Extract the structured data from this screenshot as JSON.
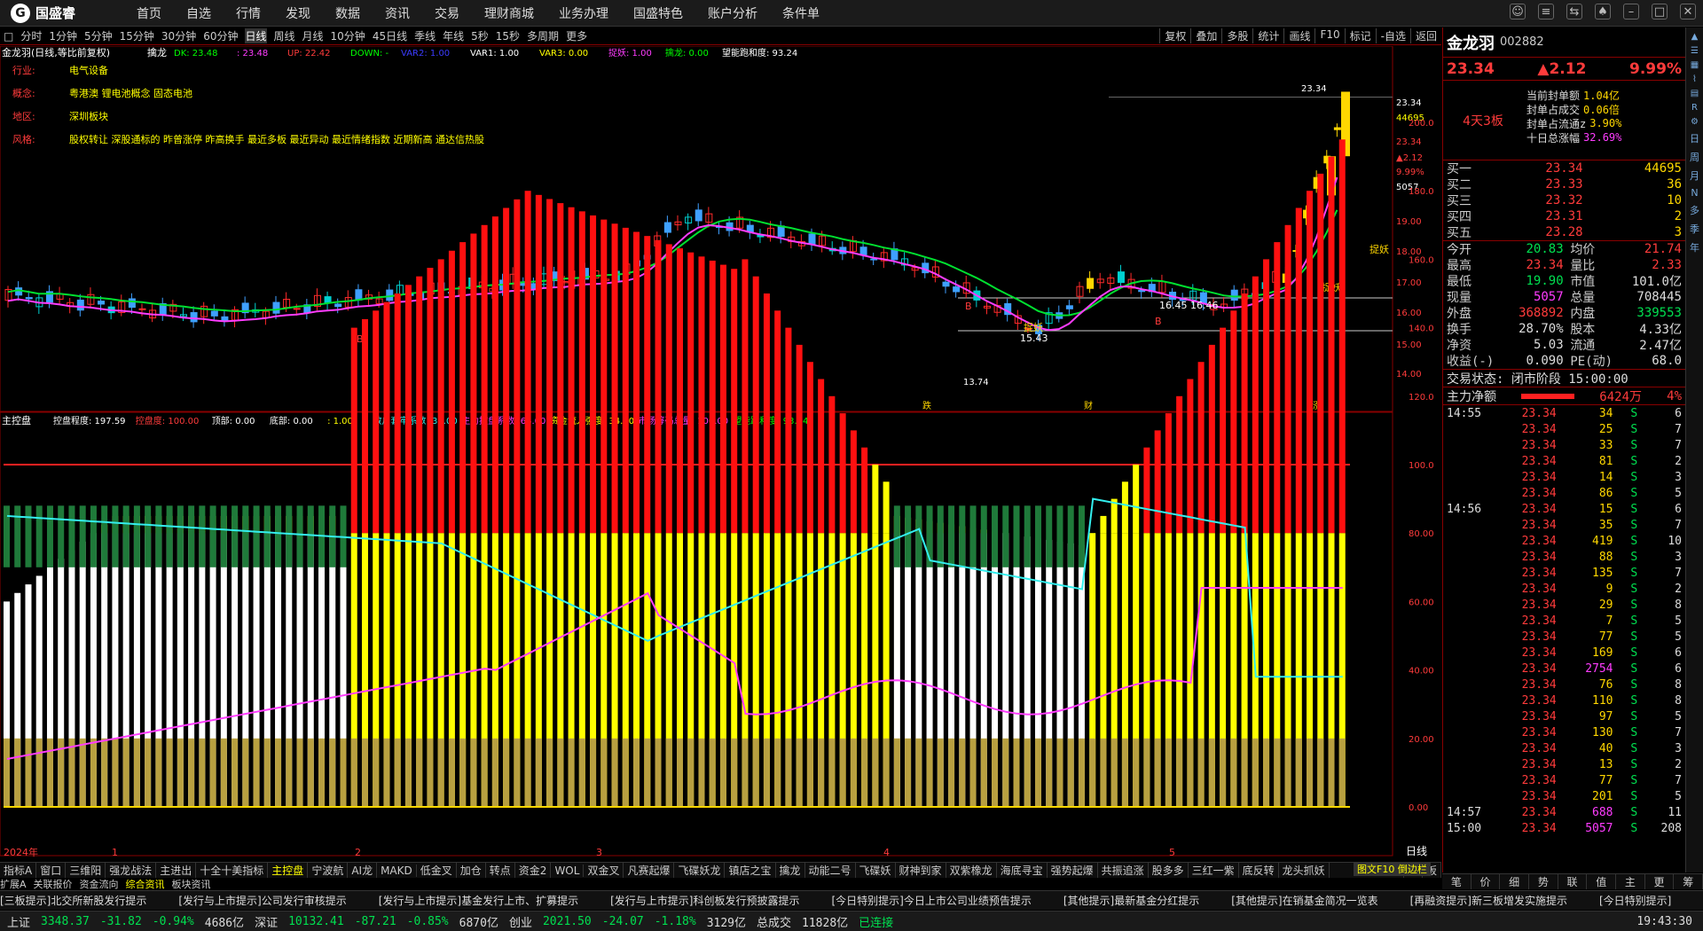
{
  "app": {
    "logo": "国盛睿"
  },
  "menu": [
    "首页",
    "自选",
    "行情",
    "发现",
    "数据",
    "资讯",
    "交易",
    "理财商城",
    "业务办理",
    "国盛特色",
    "账户分析",
    "条件单"
  ],
  "window_icons": [
    "message-icon",
    "menu-icon",
    "restore-icon",
    "skin-icon",
    "minimize-icon",
    "maximize-icon",
    "close-icon"
  ],
  "periods": [
    "分时",
    "1分钟",
    "5分钟",
    "15分钟",
    "30分钟",
    "60分钟",
    "日线",
    "周线",
    "月线",
    "10分钟",
    "45日线",
    "季线",
    "年线",
    "5秒",
    "15秒",
    "多周期",
    "更多"
  ],
  "active_period": "日线",
  "toolbar_right": [
    "复权",
    "叠加",
    "多股",
    "统计",
    "画线",
    "F10",
    "标记",
    "-自选",
    "返回"
  ],
  "kline": {
    "title": "金龙羽(日线,等比前复权)",
    "indicator": "擒龙",
    "params": [
      {
        "t": "DK: 23.48",
        "c": "#00ff00"
      },
      {
        "t": ": 23.48",
        "c": "#ff3cff"
      },
      {
        "t": "UP: 22.42",
        "c": "#ff3b3b"
      },
      {
        "t": "DOWN: -",
        "c": "#00ff00"
      },
      {
        "t": "VAR2: 1.00",
        "c": "#3b3bff"
      },
      {
        "t": "VAR1: 1.00",
        "c": "#ffffff"
      },
      {
        "t": "VAR3: 0.00",
        "c": "#ffff00"
      },
      {
        "t": "捉妖: 1.00",
        "c": "#ff3cff"
      },
      {
        "t": "擒龙: 0.00",
        "c": "#00ff00"
      },
      {
        "t": "望能跑和度: 93.24",
        "c": "#ffffff"
      }
    ],
    "info": [
      {
        "k": "行业:",
        "v": "电气设备"
      },
      {
        "k": "概念:",
        "v": "粤港澳 锂电池概念 固态电池"
      },
      {
        "k": "地区:",
        "v": "深圳板块"
      },
      {
        "k": "风格:",
        "v": "股权转让 深股通标的 昨曾涨停 昨高换手 最近多板 最近异动 最近情绪指数 近期新高 通达信热股"
      }
    ],
    "yaxis": [
      "23.34",
      "44695",
      "23.34",
      "▲2.12",
      "9.99%",
      "5057",
      "19.00",
      "18.00",
      "17.00",
      "16.00",
      "15.00",
      "14.00"
    ],
    "low_label": "13.74",
    "high_label": "23.34",
    "annotations": [
      "捉妖",
      "捉妖",
      "捉妖",
      "B",
      "B",
      "B",
      "15.43",
      "16.45",
      "16.46"
    ],
    "markers": [
      "跌",
      "财",
      "涨"
    ]
  },
  "osc": {
    "title": "主控盘",
    "params": [
      {
        "t": "控盘程度: 197.59",
        "c": "#ffffff"
      },
      {
        "t": "控盘度: 100.00",
        "c": "#ff3b3b"
      },
      {
        "t": "顶部: 0.00",
        "c": "#ffffff"
      },
      {
        "t": "底部: 0.00",
        "c": "#ffffff"
      },
      {
        "t": ": 1.00",
        "c": "#ffff00"
      },
      {
        "t": "散户套牢系数: 35.00",
        "c": "#3ee"
      },
      {
        "t": "主力控盘系数: 64.00",
        "c": "#ff3cff"
      },
      {
        "t": "资金流入强度: 34.00",
        "c": "#ffff00"
      },
      {
        "t": "市场筹码总量: 106.00",
        "c": "#ff3cff"
      },
      {
        "t": "望能跑和度: 93.24",
        "c": "#00ff00"
      }
    ],
    "yaxis": [
      "200.0",
      "180.0",
      "160.0",
      "140.0",
      "120.0",
      "100.0",
      "80.00",
      "60.00",
      "40.00",
      "20.00",
      "0.00"
    ]
  },
  "xaxis": [
    "2024年",
    "1",
    "2",
    "3",
    "4",
    "5"
  ],
  "xaxis_right": "日线",
  "bottom_tabs": [
    "指标A",
    "窗口",
    "三维阳",
    "强龙战法",
    "主进出",
    "十全十美指标",
    "主控盘",
    "宁波航",
    "AI龙",
    "MAKD",
    "低金叉",
    "加仓",
    "转点",
    "资金2",
    "WOL",
    "双金叉",
    "凡赛起爆",
    "飞碟妖龙",
    "镇店之宝",
    "擒龙",
    "动能二号",
    "飞碟妖",
    "财神到家",
    "双紫橡龙",
    "海底寻宝",
    "强势起爆",
    "共振追涨",
    "股多多",
    "三红一紫",
    "底反转",
    "龙头抓妖"
  ],
  "bottom_tabs_right": [
    "指标B",
    "模",
    "板"
  ],
  "active_tab": "主控盘",
  "subtabs": [
    "扩展A",
    "关联报价",
    "资金流向",
    "综合资讯",
    "板块资讯"
  ],
  "quote": {
    "name": "金龙羽",
    "code": "002882",
    "price": "23.34",
    "change": "▲2.12",
    "pct": "9.99%",
    "limit": {
      "label": "4天3板",
      "rows": [
        {
          "k": "当前封单额",
          "v": "1.04亿"
        },
        {
          "k": "封单占成交",
          "v": "0.06倍"
        },
        {
          "k": "封单占流通z",
          "v": "3.90%"
        },
        {
          "k": "十日总涨幅",
          "v": "32.69%"
        }
      ]
    },
    "buys": [
      {
        "k": "买一",
        "p": "23.34",
        "v": "44695"
      },
      {
        "k": "买二",
        "p": "23.33",
        "v": "36"
      },
      {
        "k": "买三",
        "p": "23.32",
        "v": "10"
      },
      {
        "k": "买四",
        "p": "23.31",
        "v": "2"
      },
      {
        "k": "买五",
        "p": "23.28",
        "v": "3"
      }
    ],
    "stats": [
      {
        "k1": "今开",
        "v1": "20.83",
        "c1": "green",
        "k2": "均价",
        "v2": "21.74",
        "c2": "red"
      },
      {
        "k1": "最高",
        "v1": "23.34",
        "c1": "red",
        "k2": "量比",
        "v2": "2.33",
        "c2": "red"
      },
      {
        "k1": "最低",
        "v1": "19.90",
        "c1": "green",
        "k2": "市值",
        "v2": "101.0亿",
        "c2": "white"
      },
      {
        "k1": "现量",
        "v1": "5057",
        "c1": "mag",
        "k2": "总量",
        "v2": "708445",
        "c2": "white"
      },
      {
        "k1": "外盘",
        "v1": "368892",
        "c1": "red",
        "k2": "内盘",
        "v2": "339553",
        "c2": "green"
      },
      {
        "k1": "换手",
        "v1": "28.70%",
        "c1": "white",
        "k2": "股本",
        "v2": "4.33亿",
        "c2": "white"
      },
      {
        "k1": "净资",
        "v1": "5.03",
        "c1": "white",
        "k2": "流通",
        "v2": "2.47亿",
        "c2": "white"
      },
      {
        "k1": "收益(-)",
        "v1": "0.090",
        "c1": "white",
        "k2": "PE(动)",
        "v2": "68.0",
        "c2": "white"
      }
    ],
    "state": "交易状态: 闭市阶段 15:00:00",
    "main_flow": {
      "label": "主力净额",
      "value": "6424万",
      "pct": "4%"
    },
    "ticks": [
      {
        "t": "14:55",
        "p": "23.34",
        "v": "34",
        "c": "6"
      },
      {
        "t": "",
        "p": "23.34",
        "v": "25",
        "c": "7"
      },
      {
        "t": "",
        "p": "23.34",
        "v": "33",
        "c": "7"
      },
      {
        "t": "",
        "p": "23.34",
        "v": "81",
        "c": "2"
      },
      {
        "t": "",
        "p": "23.34",
        "v": "14",
        "c": "3"
      },
      {
        "t": "",
        "p": "23.34",
        "v": "86",
        "c": "5"
      },
      {
        "t": "14:56",
        "p": "23.34",
        "v": "15",
        "c": "6"
      },
      {
        "t": "",
        "p": "23.34",
        "v": "35",
        "c": "7"
      },
      {
        "t": "",
        "p": "23.34",
        "v": "419",
        "c": "10"
      },
      {
        "t": "",
        "p": "23.34",
        "v": "88",
        "c": "3"
      },
      {
        "t": "",
        "p": "23.34",
        "v": "135",
        "c": "7"
      },
      {
        "t": "",
        "p": "23.34",
        "v": "9",
        "c": "2"
      },
      {
        "t": "",
        "p": "23.34",
        "v": "29",
        "c": "8"
      },
      {
        "t": "",
        "p": "23.34",
        "v": "7",
        "c": "5"
      },
      {
        "t": "",
        "p": "23.34",
        "v": "77",
        "c": "5"
      },
      {
        "t": "",
        "p": "23.34",
        "v": "169",
        "c": "6"
      },
      {
        "t": "",
        "p": "23.34",
        "v": "2754",
        "c": "6"
      },
      {
        "t": "",
        "p": "23.34",
        "v": "76",
        "c": "8"
      },
      {
        "t": "",
        "p": "23.34",
        "v": "110",
        "c": "8"
      },
      {
        "t": "",
        "p": "23.34",
        "v": "97",
        "c": "5"
      },
      {
        "t": "",
        "p": "23.34",
        "v": "130",
        "c": "7"
      },
      {
        "t": "",
        "p": "23.34",
        "v": "40",
        "c": "3"
      },
      {
        "t": "",
        "p": "23.34",
        "v": "13",
        "c": "2"
      },
      {
        "t": "",
        "p": "23.34",
        "v": "77",
        "c": "7"
      },
      {
        "t": "",
        "p": "23.34",
        "v": "201",
        "c": "5"
      },
      {
        "t": "14:57",
        "p": "23.34",
        "v": "688",
        "c": "11"
      },
      {
        "t": "15:00",
        "p": "23.34",
        "v": "5057",
        "c": "208"
      }
    ],
    "side": "S"
  },
  "right_side_icons": [
    "up-arrow-icon",
    "list-icon",
    "grid-icon",
    "chart-icon",
    "news-icon",
    "rsi-icon",
    "settings-icon"
  ],
  "right_side_labels": [
    "日",
    "周",
    "月",
    "N",
    "多",
    "季",
    "年"
  ],
  "right_tabs": [
    "笔",
    "价",
    "细",
    "势",
    "联",
    "值",
    "主",
    "更",
    "筹"
  ],
  "right_tab_label": "图文F10 倒边栏",
  "news": [
    "[三板提示]北交所新股发行提示",
    "[发行与上市提示]公司发行审核提示",
    "[发行与上市提示]基金发行上市、扩募提示",
    "[发行与上市提示]科创板发行预披露提示",
    "[今日特别提示]今日上市公司业绩预告提示",
    "[其他提示]最新基金分红提示",
    "[其他提示]在销基金简况一览表",
    "[再融资提示]新三板增发实施提示",
    "[今日特别提示]"
  ],
  "status": {
    "sh_label": "上证",
    "sh": "3348.37",
    "sh_chg": "-31.82",
    "sh_pct": "-0.94%",
    "sh_amt": "4686亿",
    "sz_label": "深证",
    "sz": "10132.41",
    "sz_chg": "-87.21",
    "sz_pct": "-0.85%",
    "sz_amt": "6870亿",
    "cy_label": "创业",
    "cy": "2021.50",
    "cy_chg": "-24.07",
    "cy_pct": "-1.18%",
    "cy_amt": "3129亿",
    "total_label": "总成交",
    "total": "11828亿",
    "conn": "已连接",
    "time": "19:43:30"
  }
}
